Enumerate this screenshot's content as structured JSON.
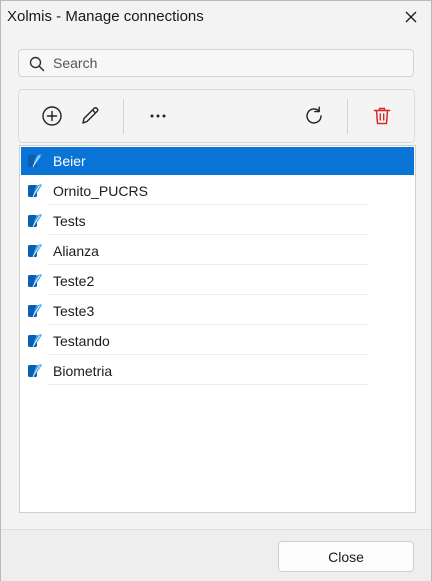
{
  "window": {
    "title": "Xolmis - Manage connections"
  },
  "search": {
    "placeholder": "Search",
    "value": ""
  },
  "toolbar": {
    "buttons": [
      {
        "name": "add",
        "icon": "plus-circle-icon"
      },
      {
        "name": "edit",
        "icon": "pencil-icon"
      },
      {
        "name": "more",
        "icon": "more-horizontal-icon"
      },
      {
        "name": "refresh",
        "icon": "refresh-icon"
      },
      {
        "name": "delete",
        "icon": "trash-icon",
        "color": "#d62828"
      }
    ]
  },
  "connections": {
    "selected_index": 0,
    "items": [
      {
        "label": "Beier"
      },
      {
        "label": "Ornito_PUCRS"
      },
      {
        "label": "Tests"
      },
      {
        "label": "Alianza"
      },
      {
        "label": "Teste2"
      },
      {
        "label": "Teste3"
      },
      {
        "label": "Testando"
      },
      {
        "label": "Biometria"
      }
    ]
  },
  "footer": {
    "close_label": "Close"
  },
  "colors": {
    "selection": "#0a74d6",
    "db_icon": "#1a73c8",
    "delete_icon": "#d62828"
  }
}
